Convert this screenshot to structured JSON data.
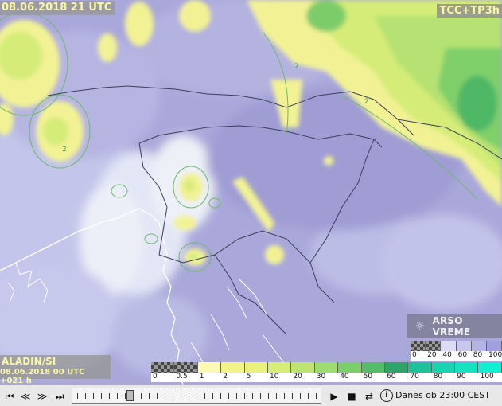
{
  "map": {
    "valid_time": "08.06.2018 21 UTC",
    "product": "TCC+TP3h",
    "model": "ALADIN/SI",
    "run": "08.06.2018 00 UTC +021 h",
    "brand": "ARSO VREME",
    "contour_label": "2"
  },
  "legend_main": {
    "ticks": [
      "0",
      "0.5",
      "1",
      "2",
      "5",
      "10",
      "20",
      "30",
      "40",
      "50",
      "60",
      "70",
      "80",
      "90",
      "100"
    ],
    "colors": [
      "checker",
      "checker",
      "#fbfab2",
      "#f3f38c",
      "#e9f27e",
      "#d6ed77",
      "#bde473",
      "#9edc6f",
      "#7bce6a",
      "#55bd68",
      "#2fa36a",
      "#1ec29a",
      "#1ad3b0",
      "#14e2c0",
      "#0ff0d2"
    ]
  },
  "legend_side": {
    "ticks": [
      "0",
      "20",
      "40",
      "60",
      "80",
      "100"
    ],
    "colors": [
      "checker",
      "checker",
      "#dcdcf4",
      "#c8c8ee",
      "#b4b4e6",
      "#a0a0de"
    ]
  },
  "toolbar": {
    "first": "⏮",
    "prev": "≪",
    "next": "≫",
    "last": "⏭",
    "play": "▶",
    "stop": "■",
    "loop": "⇄",
    "info": "i",
    "status": "Danes ob 23:00 CEST"
  },
  "slider": {
    "position": 0.22,
    "steps": 30
  }
}
